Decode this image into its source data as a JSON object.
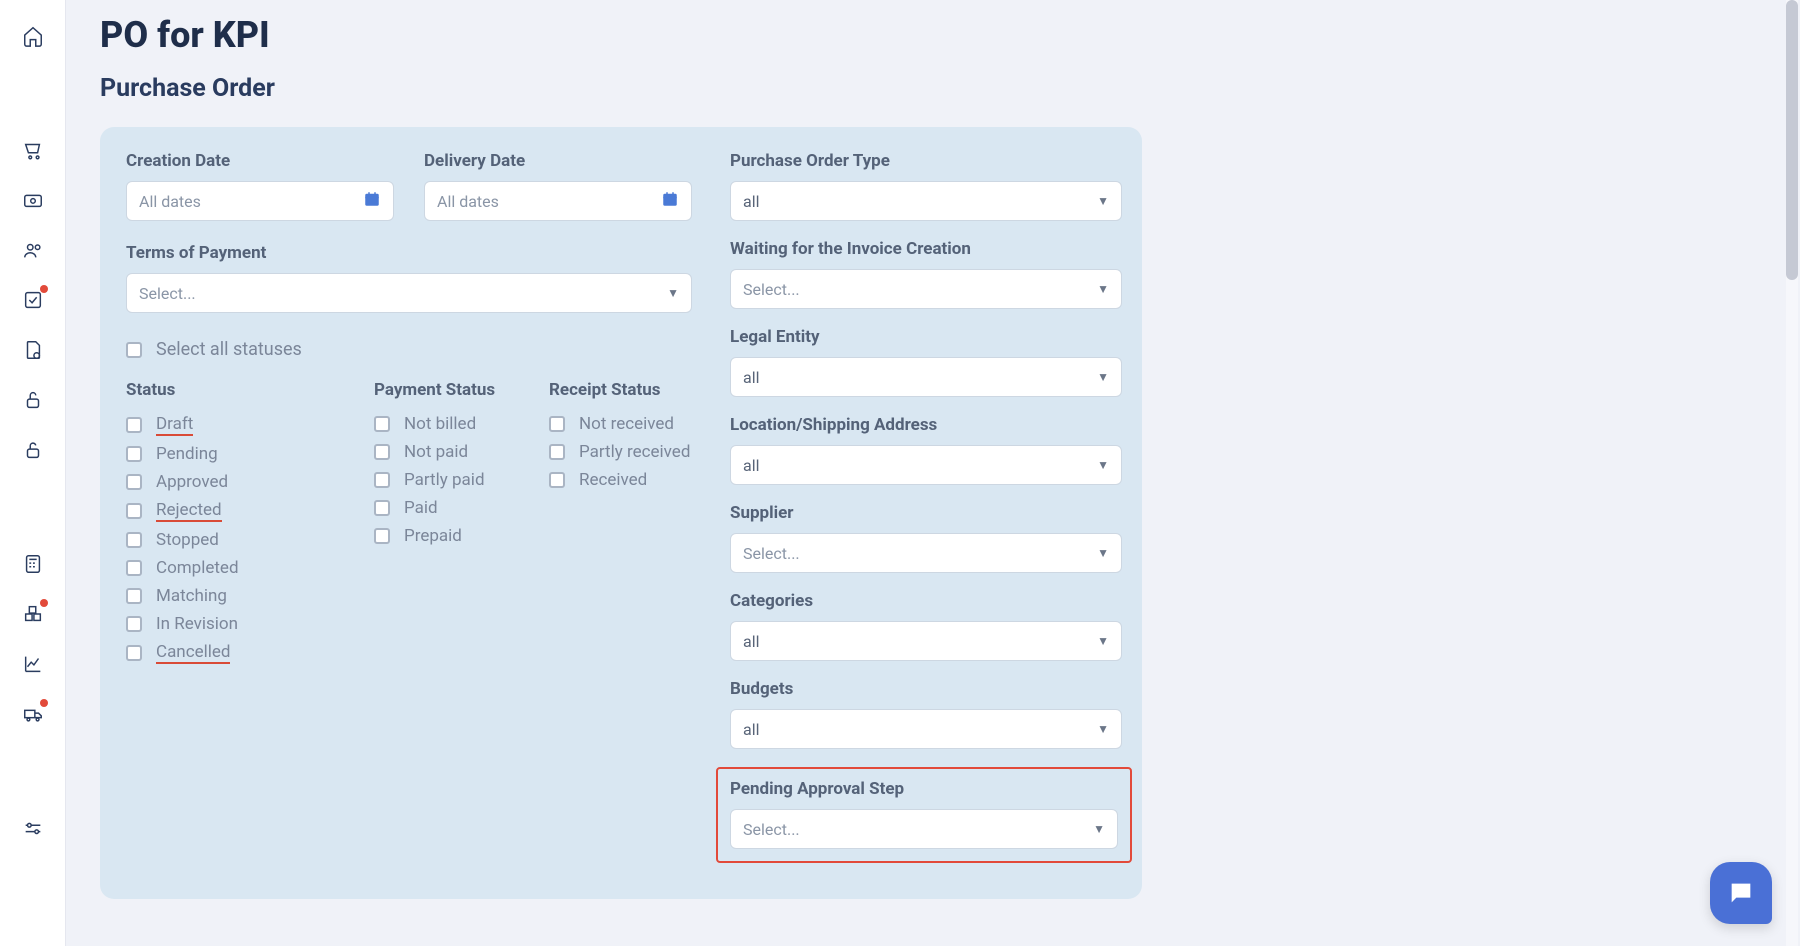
{
  "page": {
    "title": "PO for KPI",
    "subtitle": "Purchase Order"
  },
  "filters": {
    "creation_date": {
      "label": "Creation Date",
      "placeholder": "All dates"
    },
    "delivery_date": {
      "label": "Delivery Date",
      "placeholder": "All dates"
    },
    "terms_of_payment": {
      "label": "Terms of Payment",
      "placeholder": "Select..."
    },
    "select_all": "Select all statuses",
    "status": {
      "label": "Status",
      "options": [
        "Draft",
        "Pending",
        "Approved",
        "Rejected",
        "Stopped",
        "Completed",
        "Matching",
        "In Revision",
        "Cancelled"
      ]
    },
    "payment_status": {
      "label": "Payment Status",
      "options": [
        "Not billed",
        "Not paid",
        "Partly paid",
        "Paid",
        "Prepaid"
      ]
    },
    "receipt_status": {
      "label": "Receipt Status",
      "options": [
        "Not received",
        "Partly received",
        "Received"
      ]
    },
    "po_type": {
      "label": "Purchase Order Type",
      "value": "all"
    },
    "waiting_invoice": {
      "label": "Waiting for the Invoice Creation",
      "placeholder": "Select..."
    },
    "legal_entity": {
      "label": "Legal Entity",
      "value": "all"
    },
    "location": {
      "label": "Location/Shipping Address",
      "value": "all"
    },
    "supplier": {
      "label": "Supplier",
      "placeholder": "Select..."
    },
    "categories": {
      "label": "Categories",
      "value": "all"
    },
    "budgets": {
      "label": "Budgets",
      "value": "all"
    },
    "pending_approval": {
      "label": "Pending Approval Step",
      "placeholder": "Select..."
    }
  }
}
